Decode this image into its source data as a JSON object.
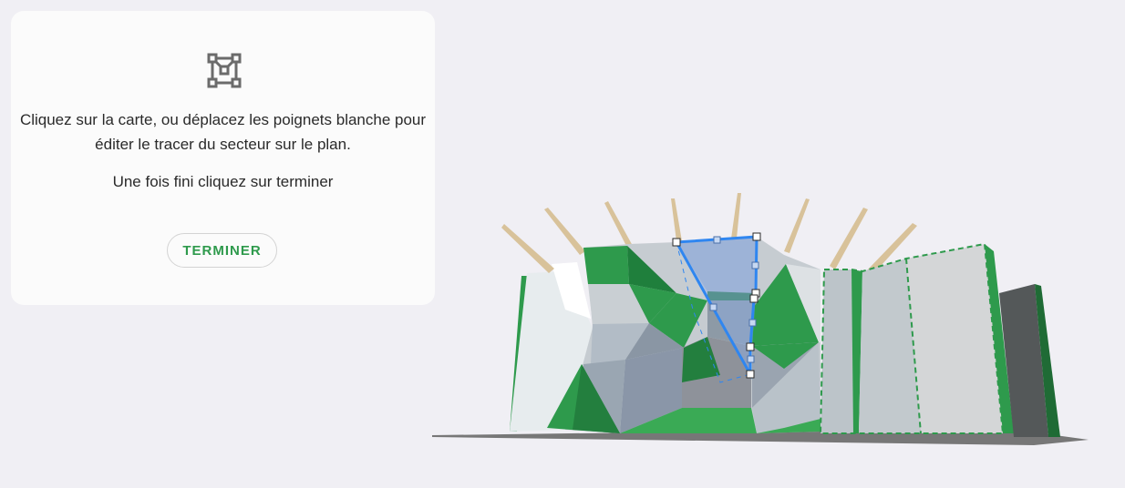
{
  "panel": {
    "icon": "vector-polygon-edit-icon",
    "instructions": "Cliquez sur la carte, ou déplacez les poignets blanche pour éditer le tracer du secteur sur le plan.",
    "secondary": "Une fois fini cliquez sur terminer",
    "finish_label": "TERMINER",
    "accent_color": "#2e9a4c"
  },
  "map": {
    "wall_green": "#2e9a4c",
    "selection_color": "#2f86f0",
    "handle_color": "#ffffff"
  }
}
